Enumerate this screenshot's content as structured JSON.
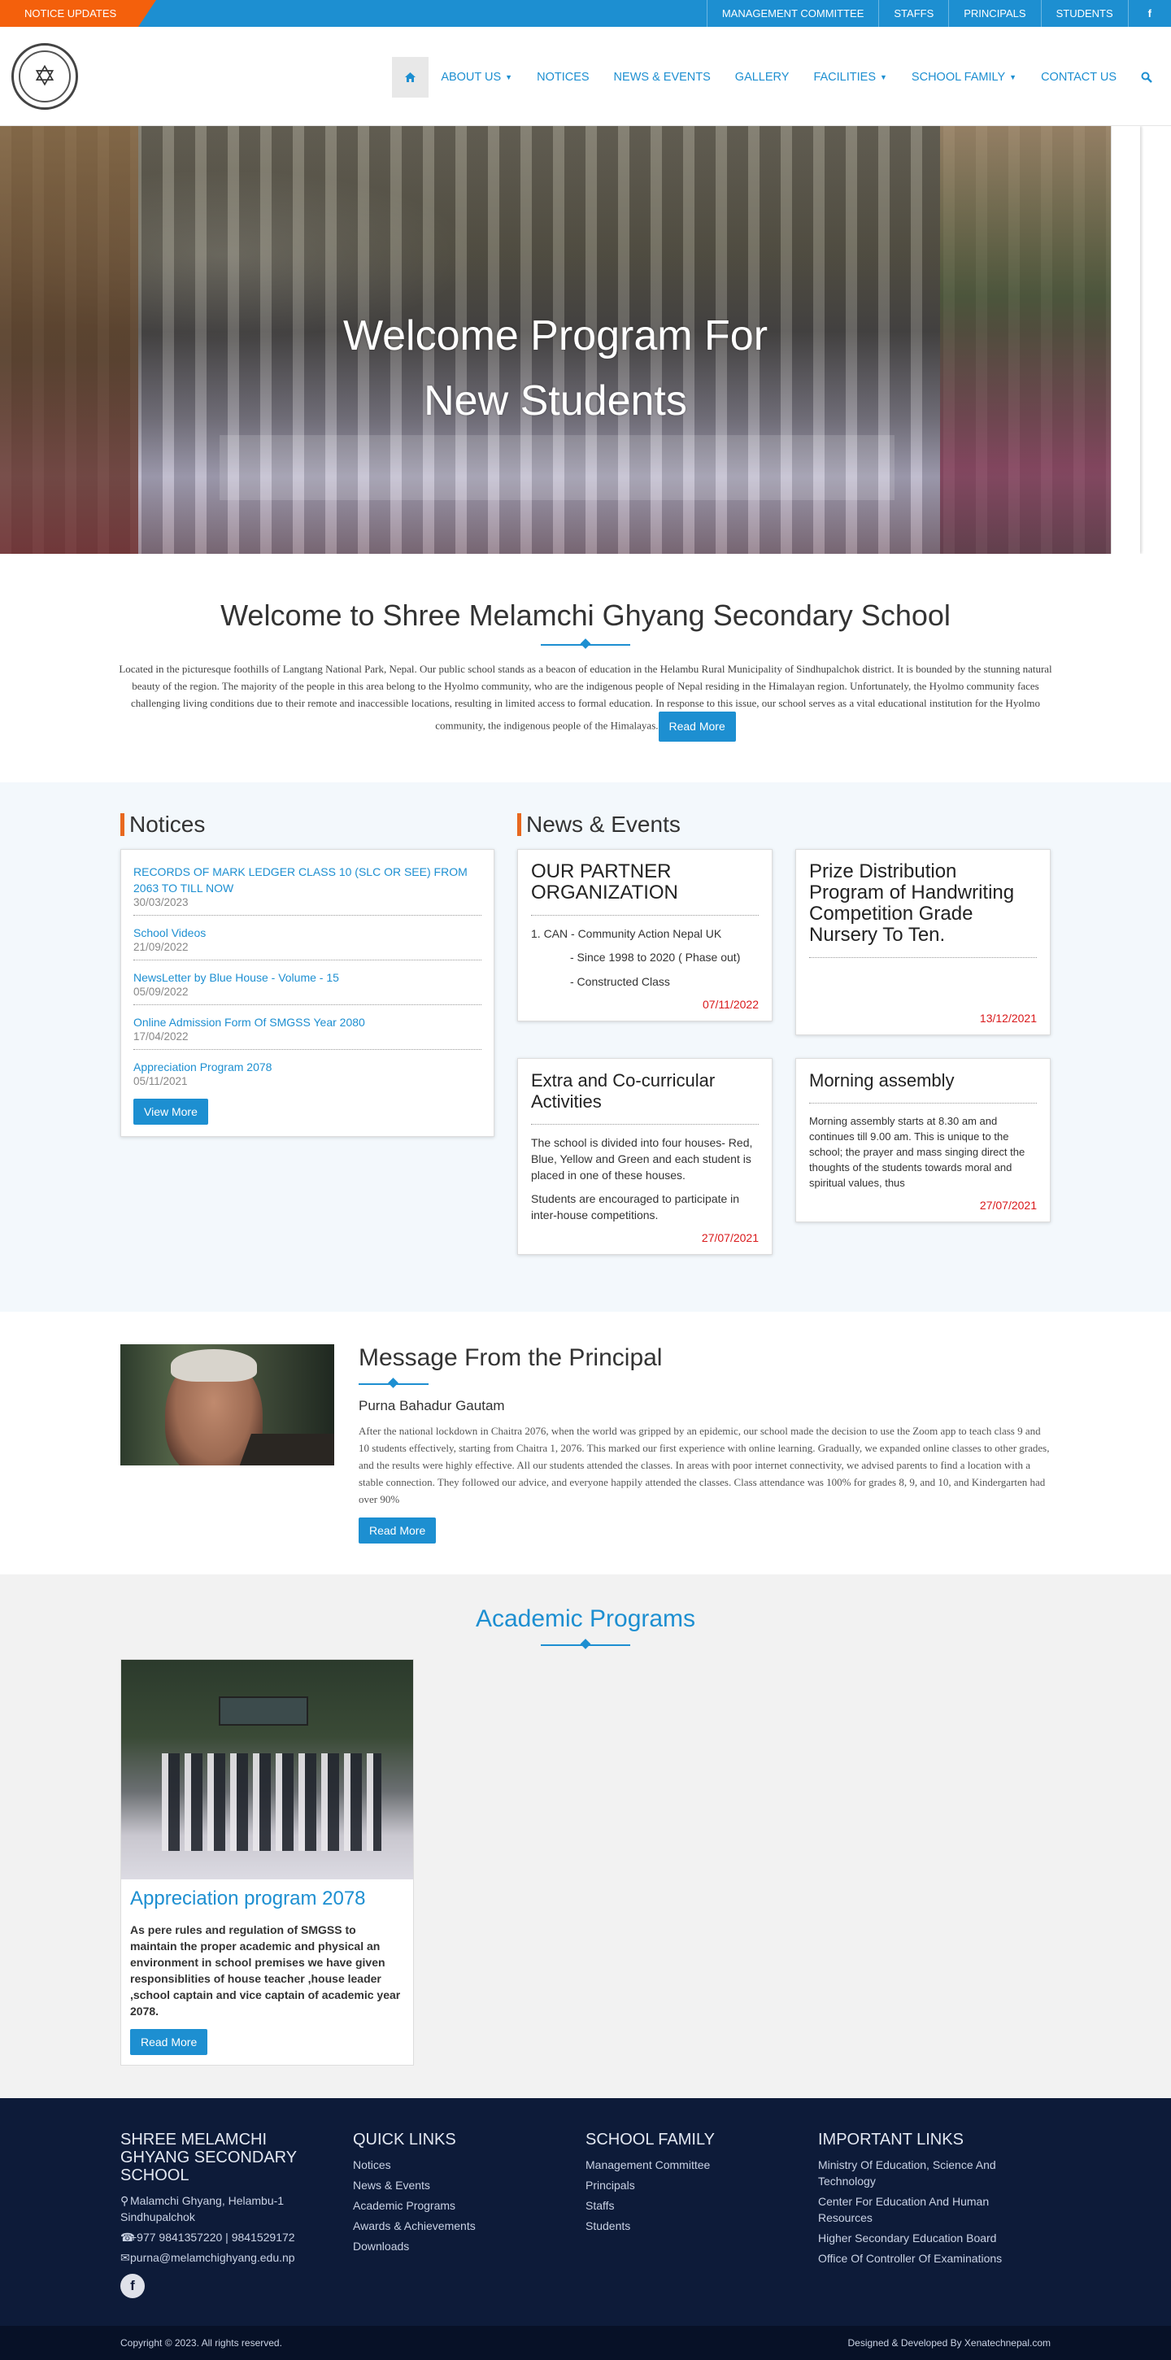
{
  "topbar": {
    "notice_label": "NOTICE UPDATES",
    "links": [
      "MANAGEMENT COMMITTEE",
      "STAFFS",
      "PRINCIPALS",
      "STUDENTS"
    ],
    "facebook": "f"
  },
  "nav": {
    "home_icon": "home-icon",
    "about": "ABOUT US",
    "notices": "NOTICES",
    "news": "NEWS & EVENTS",
    "gallery": "GALLERY",
    "facilities": "FACILITIES",
    "family": "SCHOOL FAMILY",
    "contact": "CONTACT US",
    "search_icon": "search-icon"
  },
  "hero": {
    "caption": "Welcome Program For New Students"
  },
  "welcome": {
    "title": "Welcome to Shree Melamchi Ghyang Secondary School",
    "text": "Located in the picturesque foothills of Langtang National Park, Nepal. Our public school stands as a beacon of education in the Helambu Rural Municipality of Sindhupalchok district. It is bounded by the stunning natural beauty of the region. The majority of the people in this area belong to the Hyolmo community, who are the indigenous people of Nepal residing in the Himalayan region. Unfortunately, the Hyolmo community faces challenging living conditions due to their remote and inaccessible locations, resulting in limited access to formal education. In response to this issue, our school serves as a vital educational institution for the Hyolmo community, the indigenous people of the Himalayas.",
    "button": "Read More"
  },
  "notices": {
    "title": "Notices",
    "items": [
      {
        "title": "RECORDS OF MARK LEDGER CLASS 10 (SLC OR SEE) FROM 2063 TO TILL NOW",
        "date": "30/03/2023"
      },
      {
        "title": "School Videos",
        "date": "21/09/2022"
      },
      {
        "title": "NewsLetter by Blue House - Volume - 15",
        "date": "05/09/2022"
      },
      {
        "title": "Online Admission Form Of SMGSS Year 2080",
        "date": "17/04/2022"
      },
      {
        "title": "Appreciation Program 2078",
        "date": "05/11/2021"
      }
    ],
    "button": "View More"
  },
  "news": {
    "title": "News & Events",
    "cards": [
      {
        "title": "OUR PARTNER ORGANIZATION",
        "line1": "1. CAN - Community Action Nepal UK",
        "line2": "- Since 1998 to 2020 ( Phase out)",
        "line3": "- Constructed Class",
        "date": "07/11/2022"
      },
      {
        "title": "Prize Distribution Program of Handwriting Competition Grade Nursery To Ten.",
        "date": "13/12/2021"
      },
      {
        "title": "Extra and Co-curricular Activities",
        "p1": "The school is divided into four houses- Red, Blue, Yellow and Green and each student is placed in one of these houses.",
        "p2": "Students are encouraged to participate in inter-house competitions.",
        "date": "27/07/2021"
      },
      {
        "title": "Morning assembly",
        "p1": "Morning assembly starts at 8.30 am and continues till 9.00 am. This is unique to the school; the prayer and mass singing direct the thoughts of the students towards moral and spiritual values, thus",
        "date": "27/07/2021"
      }
    ]
  },
  "principal": {
    "title": "Message From the Principal",
    "name": "Purna Bahadur Gautam",
    "text": "After the national lockdown in Chaitra 2076, when the world was gripped by an epidemic, our school made the decision to use the Zoom app to teach class 9 and 10 students effectively, starting from Chaitra 1, 2076. This marked our first experience with online learning. Gradually, we expanded online classes to other grades, and the results were highly effective. All our students attended the classes. In areas with poor internet connectivity, we advised parents to find a location with a stable connection. They followed our advice, and everyone happily attended the classes. Class attendance was 100% for grades 8, 9, and 10, and Kindergarten had over 90%",
    "button": "Read More"
  },
  "academic": {
    "title": "Academic Programs",
    "card": {
      "title": "Appreciation program 2078",
      "text": "As pere rules and regulation of SMGSS to maintain the proper academic and physical an environment in school premises we have given responsiblities of house teacher ,house leader ,school captain and vice captain of academic  year 2078.",
      "button": "Read More"
    }
  },
  "footer": {
    "school": {
      "title": "SHREE MELAMCHI GHYANG SECONDARY SCHOOL",
      "address": "Malamchi Ghyang, Helambu-1 Sindhupalchok",
      "phone": "+977 9841357220 | 9841529172",
      "email": "purna@melamchighyang.edu.np",
      "facebook": "f"
    },
    "quick": {
      "title": "QUICK LINKS",
      "links": [
        "Notices",
        "News & Events",
        "Academic Programs",
        "Awards & Achievements",
        "Downloads"
      ]
    },
    "family": {
      "title": "SCHOOL FAMILY",
      "links": [
        "Management Committee",
        "Principals",
        "Staffs",
        "Students"
      ]
    },
    "important": {
      "title": "IMPORTANT LINKS",
      "links": [
        "Ministry Of Education, Science And Technology",
        "Center For Education And Human Resources",
        "Higher Secondary Education Board",
        "Office Of Controller Of Examinations"
      ]
    },
    "copyright": "Copyright © 2023. All rights reserved.",
    "credit": "Designed & Developed By Xenatechnepal.com"
  }
}
